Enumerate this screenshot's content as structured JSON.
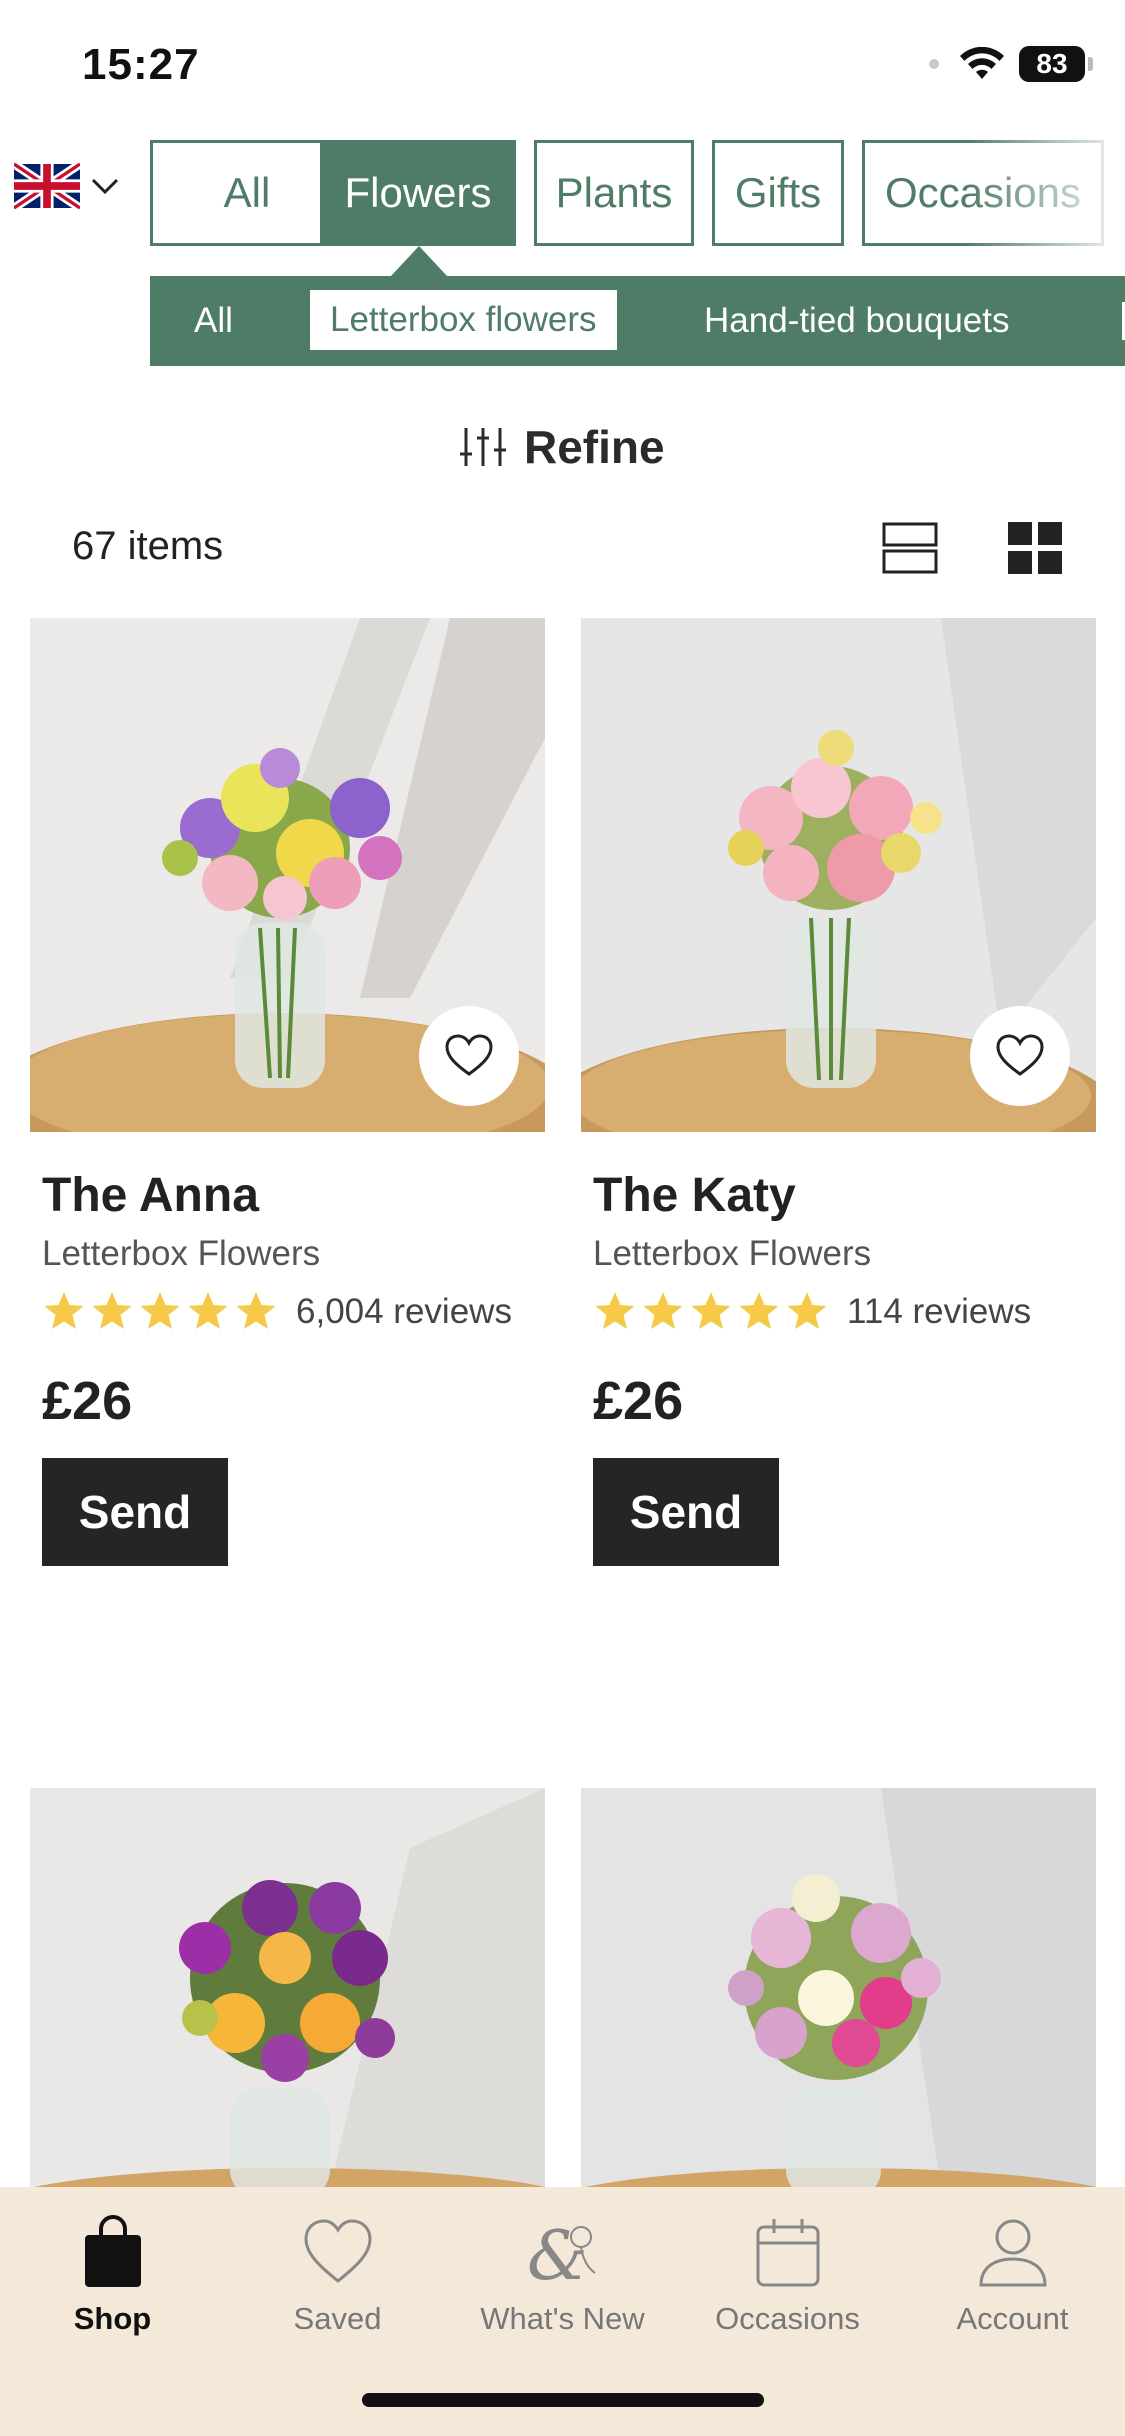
{
  "status_bar": {
    "time": "15:27",
    "battery": "83"
  },
  "region_selector": {
    "icon": "uk-flag-icon"
  },
  "categories": [
    {
      "label": "All",
      "active": false
    },
    {
      "label": "Flowers",
      "active": true
    },
    {
      "label": "Plants",
      "active": false
    },
    {
      "label": "Gifts",
      "active": false
    },
    {
      "label": "Occasions",
      "active": false
    }
  ],
  "subcategories": [
    {
      "label": "All",
      "active": false
    },
    {
      "label": "Letterbox flowers",
      "active": true
    },
    {
      "label": "Hand-tied bouquets",
      "active": false
    }
  ],
  "refine": {
    "label": "Refine"
  },
  "listing": {
    "count_label": "67 items"
  },
  "products": [
    {
      "name": "The Anna",
      "subtitle": "Letterbox Flowers",
      "rating": 5,
      "reviews": "6,004 reviews",
      "price": "£26",
      "cta": "Send"
    },
    {
      "name": "The Katy",
      "subtitle": "Letterbox Flowers",
      "rating": 5,
      "reviews": "114 reviews",
      "price": "£26",
      "cta": "Send"
    },
    {
      "name": "",
      "subtitle": "",
      "rating": null,
      "reviews": "",
      "price": "",
      "cta": ""
    },
    {
      "name": "",
      "subtitle": "",
      "rating": null,
      "reviews": "",
      "price": "",
      "cta": ""
    }
  ],
  "tabs": [
    {
      "label": "Shop",
      "icon": "shopping-bag-icon",
      "active": true
    },
    {
      "label": "Saved",
      "icon": "heart-icon",
      "active": false
    },
    {
      "label": "What's New",
      "icon": "ampersand-floral-icon",
      "active": false
    },
    {
      "label": "Occasions",
      "icon": "calendar-icon",
      "active": false
    },
    {
      "label": "Account",
      "icon": "user-icon",
      "active": false
    }
  ],
  "colors": {
    "brand_green": "#4e7c66",
    "star": "#f7c948",
    "tab_bar": "#f4e9d8",
    "button_dark": "#252525"
  }
}
